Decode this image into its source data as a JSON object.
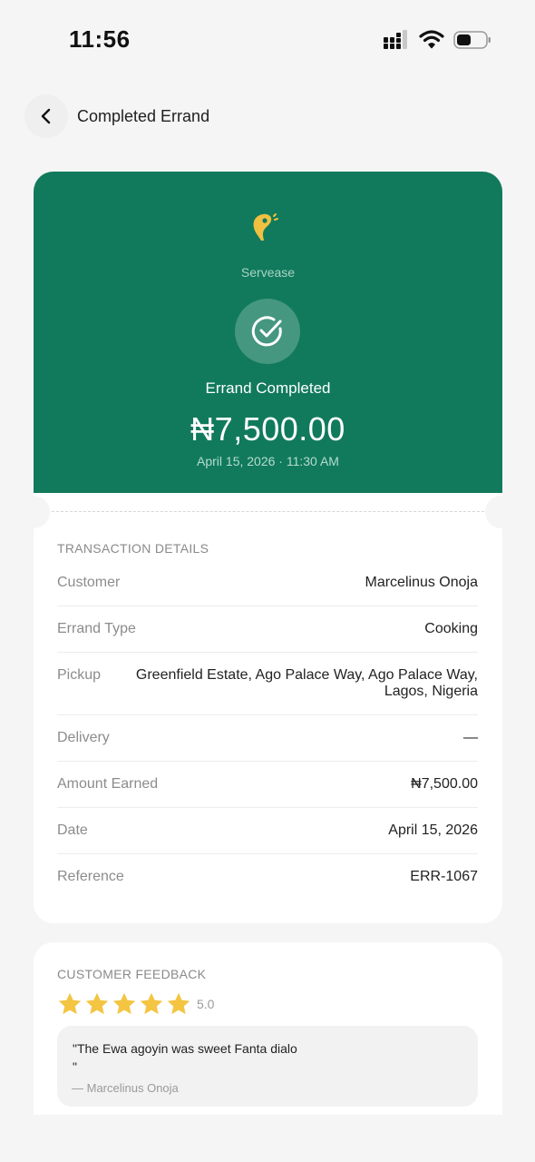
{
  "status_bar": {
    "time": "11:56"
  },
  "header": {
    "title": "Completed Errand"
  },
  "receipt": {
    "brand": "Servease",
    "status": "Errand Completed",
    "amount": "₦7,500.00",
    "datetime": "April 15, 2026 · 11:30 AM",
    "accent_color": "#117a5c"
  },
  "details": {
    "section_title": "TRANSACTION DETAILS",
    "rows": [
      {
        "label": "Customer",
        "value": "Marcelinus Onoja"
      },
      {
        "label": "Errand Type",
        "value": "Cooking"
      },
      {
        "label": "Pickup",
        "value": "Greenfield Estate, Ago Palace Way, Ago Palace Way, Lagos, Nigeria"
      },
      {
        "label": "Delivery",
        "value": "—"
      },
      {
        "label": "Amount Earned",
        "value": "₦7,500.00"
      },
      {
        "label": "Date",
        "value": "April 15, 2026"
      },
      {
        "label": "Reference",
        "value": "ERR-1067"
      }
    ]
  },
  "feedback": {
    "section_title": "CUSTOMER FEEDBACK",
    "stars": 5,
    "rating": "5.0",
    "quote": "\"The Ewa agoyin was sweet Fanta dialo\n\"",
    "author": "— Marcelinus Onoja",
    "star_color": "#f4c542"
  }
}
